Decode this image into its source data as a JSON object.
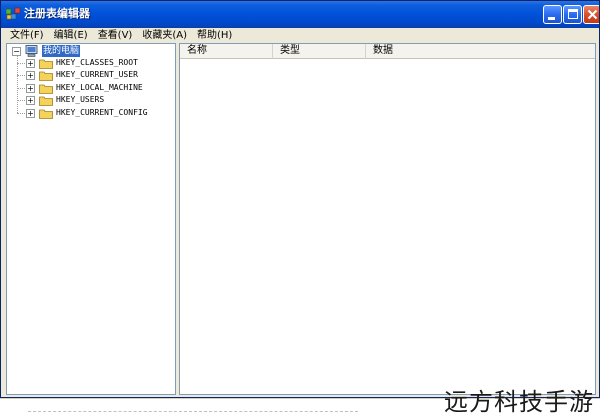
{
  "window": {
    "title": "注册表编辑器"
  },
  "menu": [
    {
      "label": "文件(F)"
    },
    {
      "label": "编辑(E)"
    },
    {
      "label": "查看(V)"
    },
    {
      "label": "收藏夹(A)"
    },
    {
      "label": "帮助(H)"
    }
  ],
  "tree": {
    "root": "我的电脑",
    "root_expander": "−",
    "children": [
      {
        "label": "HKEY_CLASSES_ROOT",
        "expander": "+"
      },
      {
        "label": "HKEY_CURRENT_USER",
        "expander": "+"
      },
      {
        "label": "HKEY_LOCAL_MACHINE",
        "expander": "+"
      },
      {
        "label": "HKEY_USERS",
        "expander": "+"
      },
      {
        "label": "HKEY_CURRENT_CONFIG",
        "expander": "+"
      }
    ]
  },
  "list": {
    "columns": [
      {
        "label": "名称"
      },
      {
        "label": "类型"
      },
      {
        "label": "数据"
      }
    ]
  },
  "watermark": "远方科技手游",
  "colors": {
    "titlebar": "#0050d8",
    "selection": "#316ac5",
    "folder": "#f3d35b",
    "window_face": "#ece9d8"
  }
}
